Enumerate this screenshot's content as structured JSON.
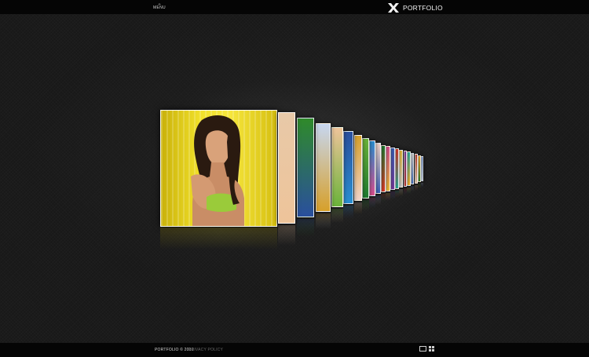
{
  "header": {
    "menu_label": "MENU",
    "brand_title": "PORTFOLIO",
    "brand_icon": "x-logo-icon"
  },
  "gallery": {
    "featured": {
      "subject": "woman-portrait-yellow-background",
      "background_color": "#f2e12a"
    },
    "stack_palette": [
      "#e8c9a8",
      "#2f8a2a",
      "#c7d7f0",
      "#eec49a",
      "#2a4f9e",
      "#d7a02a",
      "#6bb33a",
      "#2a8fd1",
      "#f3d3c7",
      "#1f7a2f",
      "#d94f8f",
      "#3a62b8",
      "#e23a2a",
      "#f0c23a",
      "#7a3a9e",
      "#2ab3a0",
      "#d6d6d6",
      "#b83a2a",
      "#ffb32a",
      "#4a7ad0"
    ]
  },
  "footer": {
    "copyright": "PORTFOLIO © 2010",
    "privacy_link": "PRIVACY POLICY",
    "view_single_icon": "single-view-icon",
    "view_grid_icon": "grid-view-icon"
  },
  "colors": {
    "background": "#181818",
    "bar": "#050505",
    "accent": "#f2e12a"
  }
}
